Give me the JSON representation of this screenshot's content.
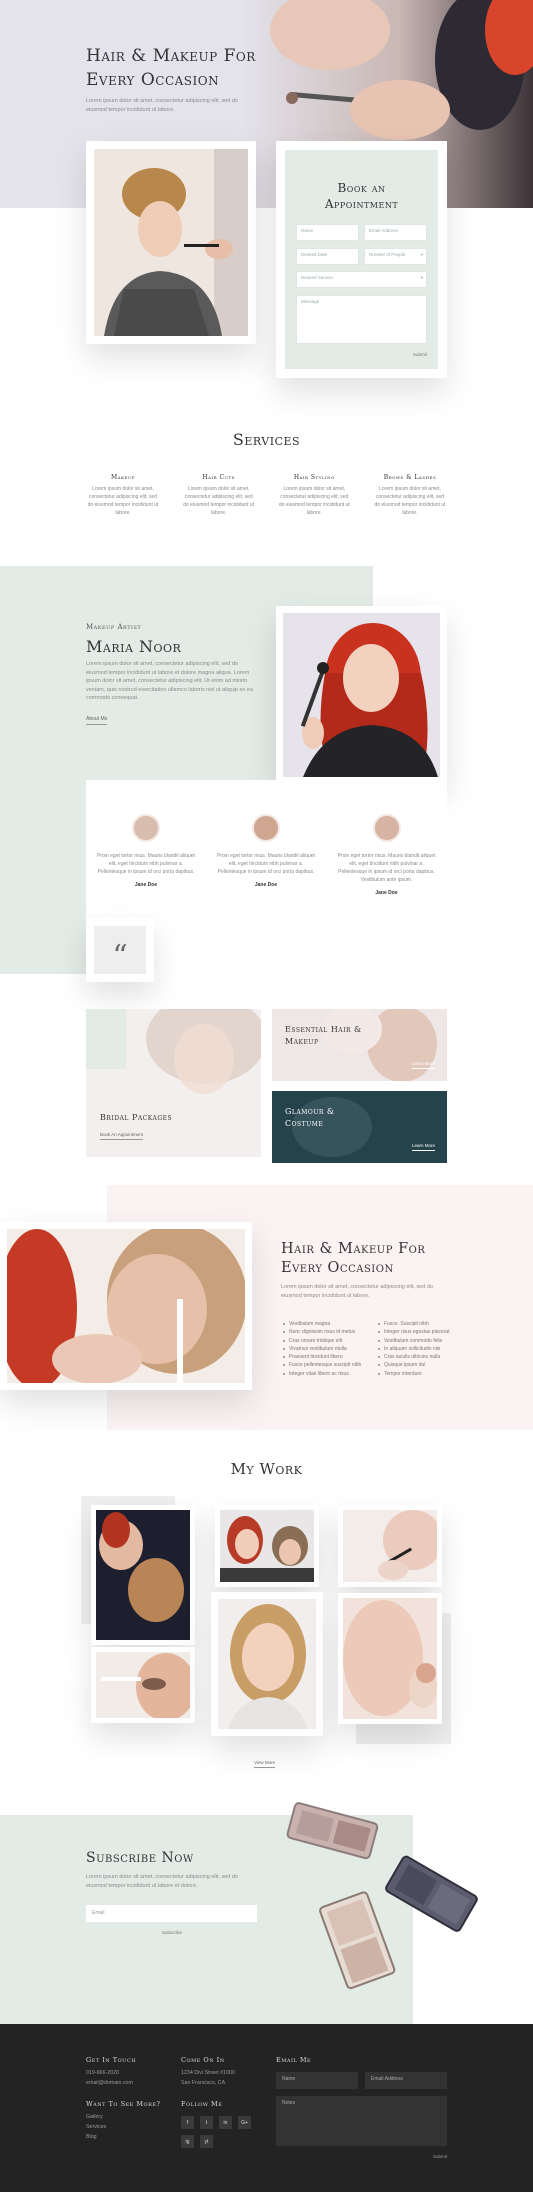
{
  "hero": {
    "title_l1": "Hair & Makeup For",
    "title_l2": "Every Occasion",
    "text": "Lorem ipsum dolor sit amet, consectetur adipiscing elit, sed do eiusmod tempor incididunt ut labore."
  },
  "booking": {
    "title_l1": "Book an",
    "title_l2": "Appointment",
    "name": "Name",
    "email": "Email Address",
    "date": "Desired Date",
    "people": "Number of People",
    "service": "Desired Service",
    "message": "Message",
    "submit": "Submit"
  },
  "services": {
    "title": "Services",
    "items": [
      {
        "name": "Makeup",
        "text": "Lorem ipsum dolor sit amet, consectetur adipiscing elit, sed do eiusmod tempor incididunt ut labore."
      },
      {
        "name": "Hair Cuts",
        "text": "Lorem ipsum dolor sit amet, consectetur adipiscing elit, sed do eiusmod tempor incididunt ut labore."
      },
      {
        "name": "Hair Styling",
        "text": "Lorem ipsum dolor sit amet, consectetur adipiscing elit, sed do eiusmod tempor incididunt ut labore."
      },
      {
        "name": "Brows & Lashes",
        "text": "Lorem ipsum dolor sit amet, consectetur adipiscing elit, sed do eiusmod tempor incididunt ut labore."
      }
    ]
  },
  "artist": {
    "role": "Makeup Artist",
    "name": "Maria Noor",
    "bio": "Lorem ipsum dolor sit amet, consectetur adipiscing elit, sed do eiusmod tempor incididunt ut labore et dolore magna aliqua. Lorem ipsum dolor sit amet, consectetur adipiscing elit. Ut enim ad minim veniam, quis nostrud exercitation ullamco laboris nisi ut aliquip ex ea commodo consequat.",
    "link": "About Me"
  },
  "testimonials": [
    {
      "text": "Proin eget tortor risus. Mauris blandit aliquet elit, eget tincidunt nibh pulvinar a. Pellentesque in ipsum id orci porta dapibus.",
      "name": "Jane Doe"
    },
    {
      "text": "Proin eget tortor risus. Mauris blandit aliquet elit, eget tincidunt nibh pulvinar a. Pellentesque in ipsum id orci porta dapibus.",
      "name": "Jane Doe"
    },
    {
      "text": "Proin eget tortor risus. Mauris blandit aliquet elit, eget tincidunt nibh pulvinar a. Pellentesque in ipsum id orci porta dapibus. Vestibulum ante ipsum.",
      "name": "Jane Doe"
    }
  ],
  "quote_glyph": "“",
  "promos": {
    "bridal": "Bridal Packages",
    "bridal_link": "Book An Appointment",
    "essential_l1": "Essential Hair &",
    "essential_l2": "Makeup",
    "essential_link": "Learn More",
    "glamour_l1": "Glamour &",
    "glamour_l2": "Costume",
    "glamour_link": "Learn More"
  },
  "occasion": {
    "title_l1": "Hair & Makeup For",
    "title_l2": "Every Occasion",
    "text": "Lorem ipsum dolor sit amet, consectetur adipiscing elit, sed do eiusmod tempor incididunt ut labore.",
    "list_left": [
      "Vestibulum magna",
      "Nunc dignissim risus id metus",
      "Cras ornare tristique elit",
      "Vivamus vestibulum ntulla",
      "Praesent tincidunt libero",
      "Fusce pellentesque suscipit nibh",
      "Integer vitae libero ac risus"
    ],
    "list_right": [
      "Fusce. Suscipit nibh",
      "Integer risus egestas placerat",
      "Vestibulum commodo felis",
      "In aliquam sollicitudin nisi",
      "Cras iaculis ultricies nulla",
      "Quisque ipsum dui",
      "Tempor interdum"
    ]
  },
  "work": {
    "title": "My Work",
    "link": "View More"
  },
  "subscribe": {
    "title": "Subscribe Now",
    "text": "Lorem ipsum dolor sit amet, consectetur adipiscing elit, sed do eiusmod tempor incididunt ut labore et dolore.",
    "email": "Email",
    "button": "Subscribe"
  },
  "footer": {
    "touch": "Get In Touch",
    "phone": "019-666-2020",
    "email": "email@domain.com",
    "come": "Come On In",
    "addr1": "1234 Divi Street #1000",
    "addr2": "San Francisco, CA",
    "more": "Want To See More?",
    "links": [
      "Gallery",
      "Services",
      "Blog"
    ],
    "follow": "Follow Me",
    "social": [
      "f",
      "t",
      "in",
      "G+",
      "ig",
      "yt"
    ],
    "emailme": "Email Me",
    "f_name": "Name",
    "f_email": "Email Address",
    "f_notes": "Notes",
    "f_submit": "Submit"
  },
  "colors": {
    "mint": "#e3ebe6",
    "blush": "#fbf3f3",
    "dark": "#232323",
    "teal": "#25434a"
  }
}
